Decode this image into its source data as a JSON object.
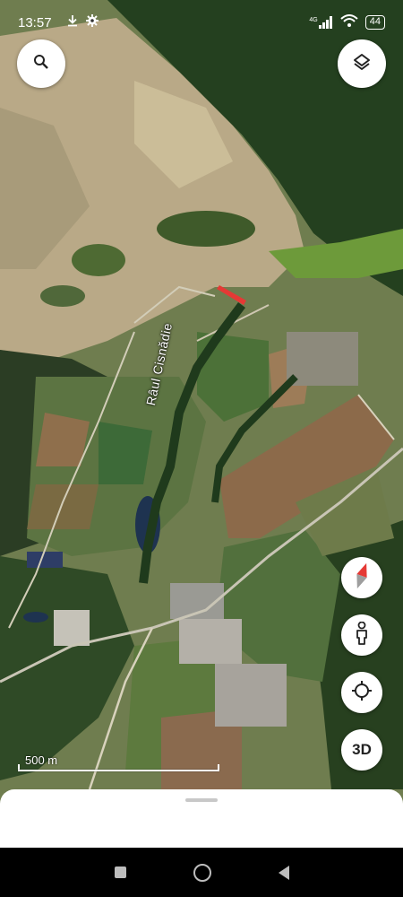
{
  "status_bar": {
    "time": "13:57",
    "network": "4G",
    "battery": "44"
  },
  "map": {
    "river_label": "Râul Cisnădie",
    "scale_label": "500 m"
  },
  "buttons": {
    "three_d": "3D"
  },
  "icons": {
    "search": "search-icon",
    "layers": "layers-icon",
    "compass": "compass-icon",
    "street_view": "pegman-icon",
    "my_location": "my-location-icon"
  },
  "colors": {
    "compass_red": "#e53935",
    "accent_dark": "#222222"
  }
}
